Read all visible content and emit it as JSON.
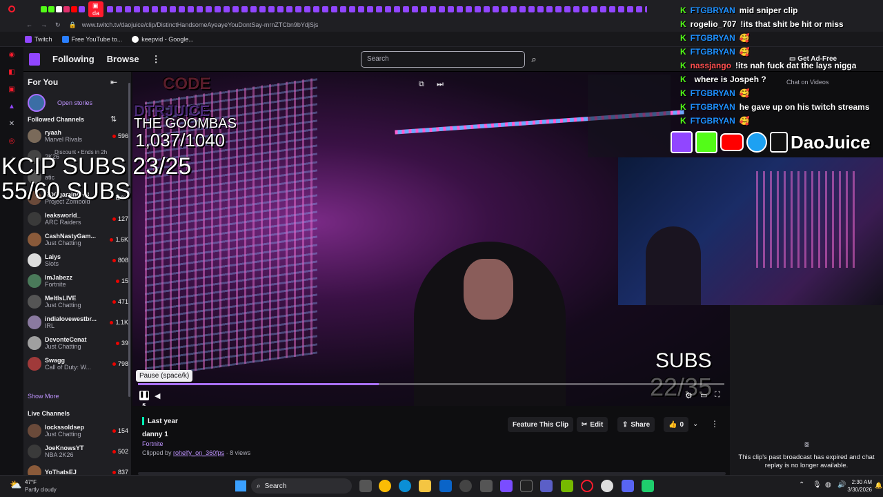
{
  "browser": {
    "tab_label": "da",
    "url": "www.twitch.tv/daojuice/clip/DistinctHandsomeAyeayeYouDontSay-mrnZTCbn9bYdjSjs",
    "bookmarks": [
      "Twitch",
      "Free YouTube to...",
      "keepvid - Google..."
    ]
  },
  "nav": {
    "following": "Following",
    "browse": "Browse",
    "more": "⋮",
    "search_placeholder": "Search",
    "get_ad_free": "Get Ad-Free"
  },
  "sidebar": {
    "title": "For You",
    "open_stories": "Open stories",
    "followed_title": "Followed Channels",
    "show_more": "Show More",
    "live_title": "Live Channels",
    "followed": [
      {
        "name": "ryaah",
        "game": "Marvel Rivals",
        "viewers": "596"
      },
      {
        "name": "",
        "game": "2K26",
        "viewers": ""
      },
      {
        "name": "",
        "game": "atic",
        "viewers": ""
      },
      {
        "name": "RDCgaming +3",
        "game": "Project Zomboid",
        "viewers": "6.8K"
      },
      {
        "name": "leaksworld_",
        "game": "ARC Raiders",
        "viewers": "127"
      },
      {
        "name": "CashNastyGam...",
        "game": "Just Chatting",
        "viewers": "1.6K"
      },
      {
        "name": "Laiys",
        "game": "Slots",
        "viewers": "808"
      },
      {
        "name": "ImJabezz",
        "game": "Fortnite",
        "viewers": "15"
      },
      {
        "name": "MeltlsLIVE",
        "game": "Just Chatting",
        "viewers": "471"
      },
      {
        "name": "indialovewestbr...",
        "game": "IRL",
        "viewers": "1.1K"
      },
      {
        "name": "DevonteCenat",
        "game": "Just Chatting",
        "viewers": "39"
      },
      {
        "name": "Swagg",
        "game": "Call of Duty: W...",
        "viewers": "798"
      }
    ],
    "discount": "Discount • Ends in 2h",
    "live": [
      {
        "name": "lockssoldsep",
        "game": "Just Chatting",
        "viewers": "154"
      },
      {
        "name": "JoeKnowsYT",
        "game": "NBA 2K26",
        "viewers": "502"
      },
      {
        "name": "YoThatsEJ",
        "game": "",
        "viewers": "837"
      }
    ]
  },
  "overlay": {
    "code": "CODE",
    "dtr": "DTRJUICE",
    "goombas_title": "THE GOOMBAS",
    "goombas_count": "1,037/1040",
    "kcip": "KCIP SUBS 23/25",
    "subs_line": "55/60 SUBS",
    "subs_label": "SUBS",
    "subs_count": "22/35",
    "brand": "DaoJuice"
  },
  "player": {
    "tooltip": "Pause (space/k)",
    "progress": 0.41
  },
  "clip": {
    "date": "Last year",
    "title": "danny 1",
    "game": "Fortnite",
    "clipped_by_prefix": "Clipped by",
    "clipper": "rohelfy_on_360fps",
    "views": "· 8 views",
    "feature": "Feature This Clip",
    "edit": "Edit",
    "share": "Share",
    "likes": "0",
    "chat_on_videos": "Chat on Videos"
  },
  "chat": {
    "lines": [
      {
        "user": "FTGBRYAN",
        "msg": "mid sniper clip",
        "color": "#1e90ff"
      },
      {
        "user": "rogelio_707",
        "msg": "!its that shit be hit or miss",
        "color": "#ffffff"
      },
      {
        "user": "FTGBRYAN",
        "msg": "🥰",
        "color": "#1e90ff"
      },
      {
        "user": "FTGBRYAN",
        "msg": "🥰",
        "color": "#1e90ff"
      },
      {
        "user": "nassjango",
        "msg": "!its nah fuck dat the lays nigga",
        "color": "#ff4f4f"
      },
      {
        "user": "",
        "msg": "where is Jospeh ?",
        "color": "#ffffff"
      },
      {
        "user": "FTGBRYAN",
        "msg": "🥰",
        "color": "#1e90ff"
      },
      {
        "user": "FTGBRYAN",
        "msg": "he gave up on his twitch streams",
        "color": "#1e90ff"
      },
      {
        "user": "FTGBRYAN",
        "msg": "🥰",
        "color": "#1e90ff"
      }
    ],
    "expired": "This clip's past broadcast has expired and chat replay is no longer available."
  },
  "taskbar": {
    "weather_temp": "47°F",
    "weather_desc": "Partly cloudy",
    "search": "Search",
    "time": "2:30 AM",
    "date": "3/30/2026"
  },
  "colors": {
    "twitch_purple": "#9146ff",
    "kick_green": "#53fc18",
    "live_red": "#eb0400"
  }
}
